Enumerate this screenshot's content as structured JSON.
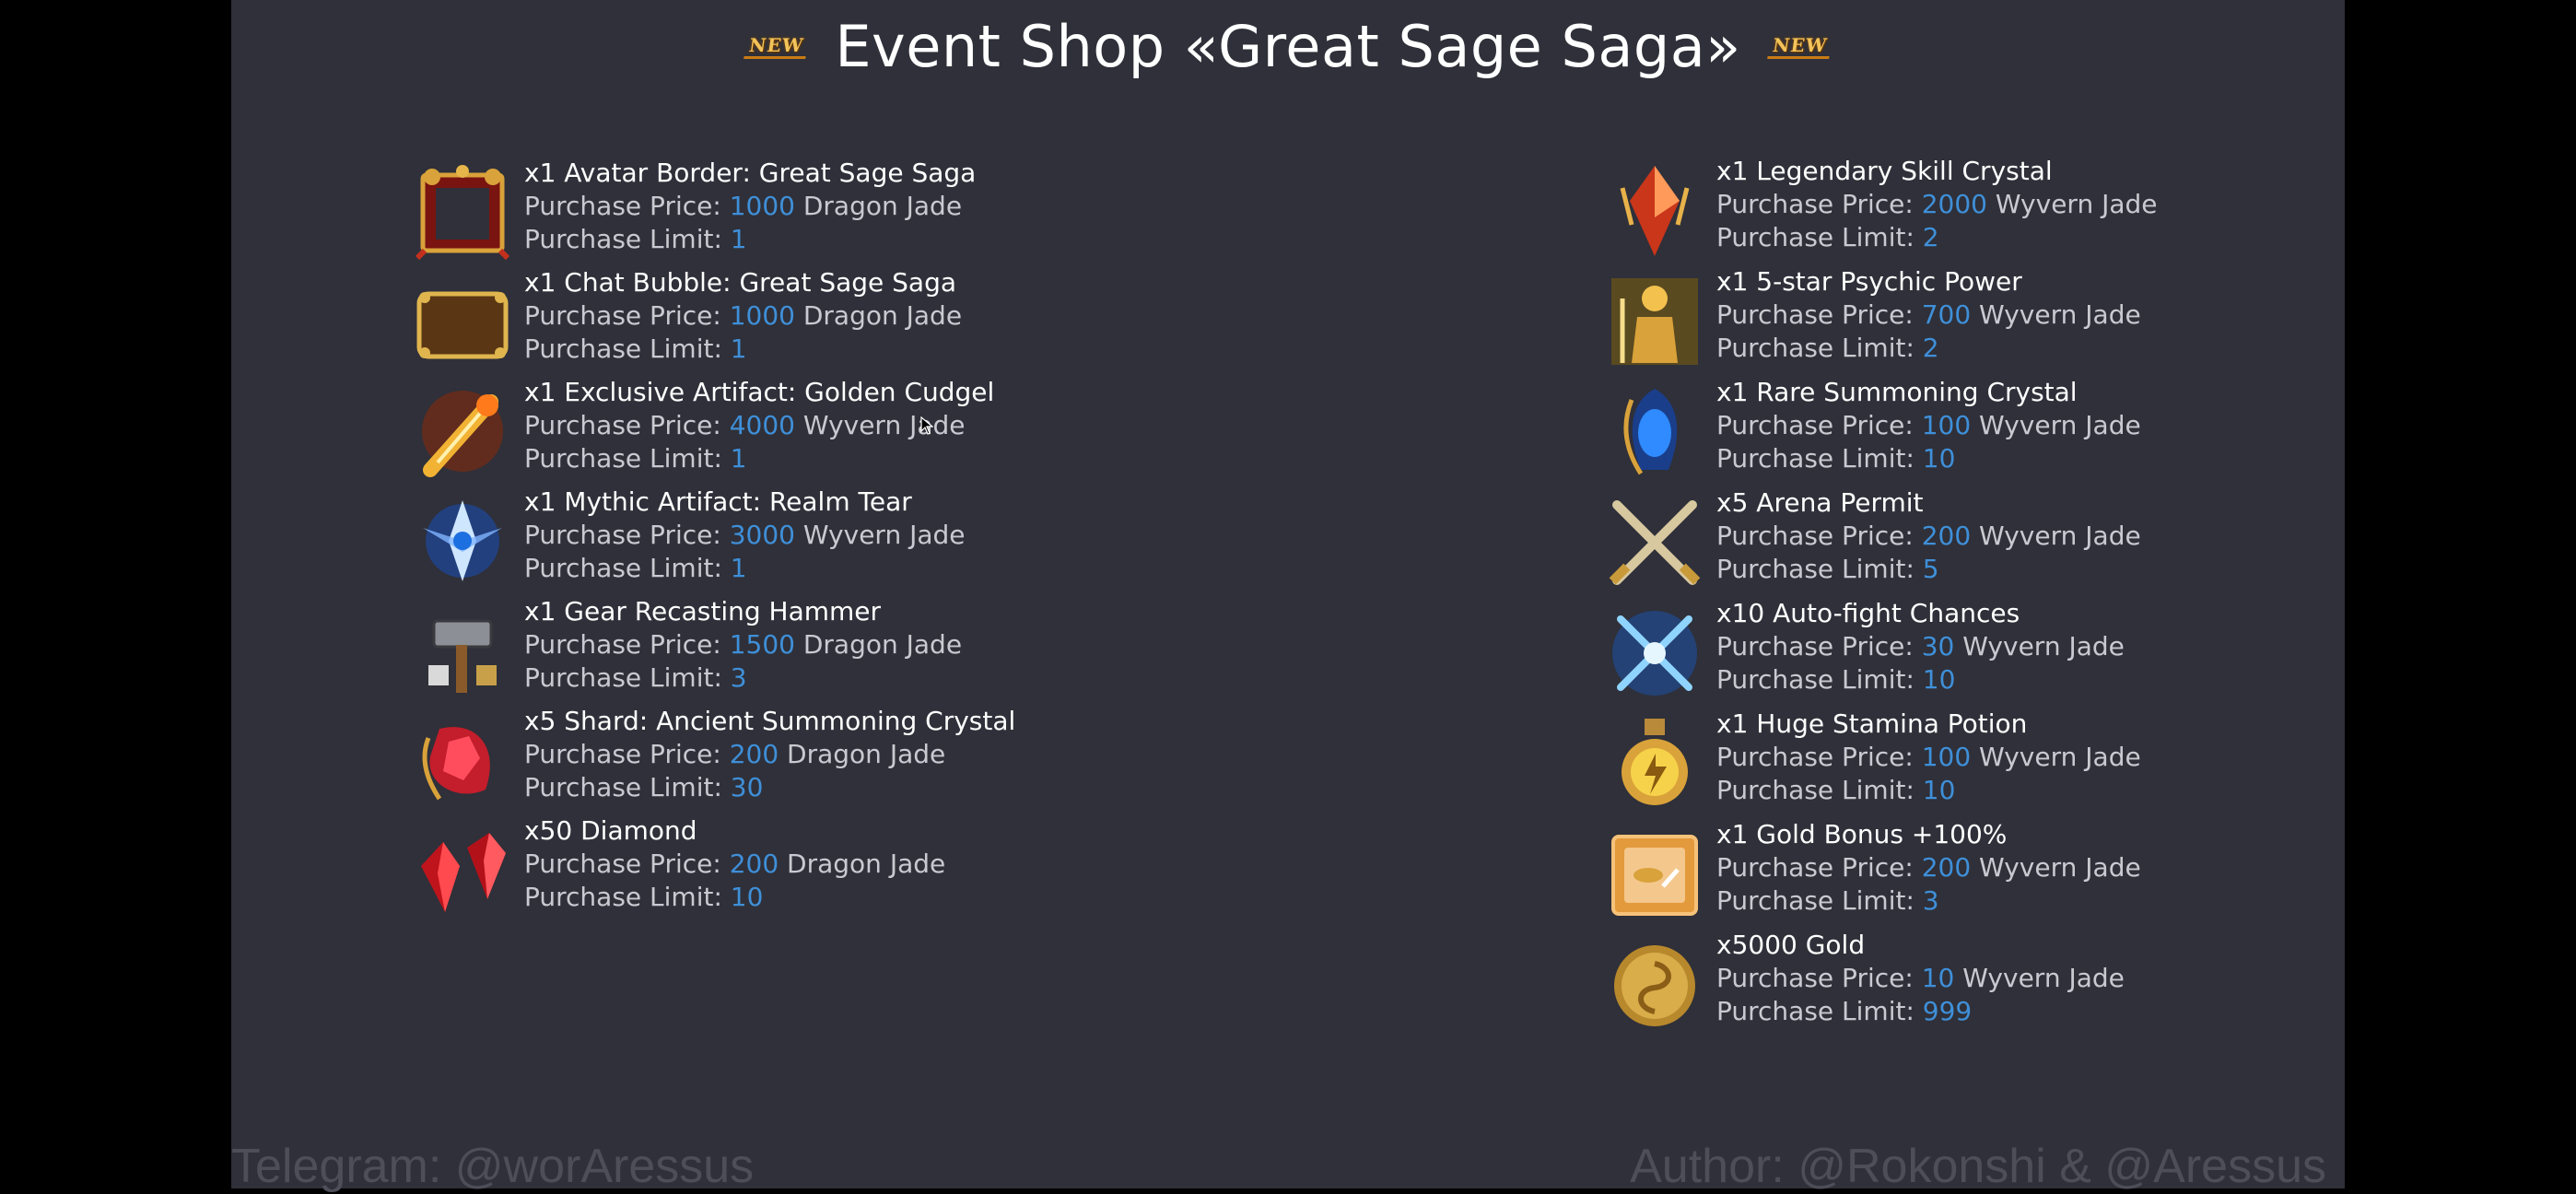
{
  "header": {
    "title": "Event Shop «Great Sage Saga»",
    "badge_left": "NEW",
    "badge_right": "NEW"
  },
  "labels": {
    "price": "Purchase Price: ",
    "limit": "Purchase Limit: "
  },
  "left_items": [
    {
      "name": "x1 Avatar Border: Great Sage Saga",
      "price": "1000",
      "currency": "Dragon Jade",
      "limit": "1",
      "icon": "avatar-border-icon"
    },
    {
      "name": "x1 Chat Bubble: Great Sage Saga",
      "price": "1000",
      "currency": "Dragon Jade",
      "limit": "1",
      "icon": "chat-bubble-icon"
    },
    {
      "name": "x1 Exclusive Artifact: Golden Cudgel",
      "price": "4000",
      "currency": "Wyvern Jade",
      "limit": "1",
      "icon": "golden-cudgel-icon"
    },
    {
      "name": "x1 Mythic Artifact: Realm Tear",
      "price": "3000",
      "currency": "Wyvern Jade",
      "limit": "1",
      "icon": "realm-tear-icon"
    },
    {
      "name": "x1 Gear Recasting Hammer",
      "price": "1500",
      "currency": "Dragon Jade",
      "limit": "3",
      "icon": "hammer-icon"
    },
    {
      "name": "x5 Shard: Ancient Summoning Crystal",
      "price": "200",
      "currency": "Dragon Jade",
      "limit": "30",
      "icon": "summoning-shard-icon"
    },
    {
      "name": "x50 Diamond",
      "price": "200",
      "currency": "Dragon Jade",
      "limit": "10",
      "icon": "diamond-icon"
    }
  ],
  "right_items": [
    {
      "name": "x1 Legendary Skill Crystal",
      "price": "2000",
      "currency": "Wyvern Jade",
      "limit": "2",
      "icon": "skill-crystal-icon"
    },
    {
      "name": "x1 5-star Psychic Power",
      "price": "700",
      "currency": "Wyvern Jade",
      "limit": "2",
      "icon": "psychic-power-icon"
    },
    {
      "name": "x1 Rare Summoning Crystal",
      "price": "100",
      "currency": "Wyvern Jade",
      "limit": "10",
      "icon": "rare-summoning-crystal-icon"
    },
    {
      "name": "x5 Arena Permit",
      "price": "200",
      "currency": "Wyvern Jade",
      "limit": "5",
      "icon": "arena-permit-icon"
    },
    {
      "name": "x10 Auto-fight Chances",
      "price": "30",
      "currency": "Wyvern Jade",
      "limit": "10",
      "icon": "auto-fight-icon"
    },
    {
      "name": "x1 Huge Stamina Potion",
      "price": "100",
      "currency": "Wyvern Jade",
      "limit": "10",
      "icon": "stamina-potion-icon"
    },
    {
      "name": "x1 Gold Bonus +100%",
      "price": "200",
      "currency": "Wyvern Jade",
      "limit": "3",
      "icon": "gold-bonus-icon"
    },
    {
      "name": "x5000 Gold",
      "price": "10",
      "currency": "Wyvern Jade",
      "limit": "999",
      "icon": "gold-coin-icon"
    }
  ],
  "footer": {
    "left": "Telegram: @worAressus",
    "right": "Author: @Rokonshi & @Aressus"
  },
  "colors": {
    "background": "#2f3039",
    "value": "#3f8fd8",
    "text": "#ffffff",
    "label": "#c9cad1"
  }
}
